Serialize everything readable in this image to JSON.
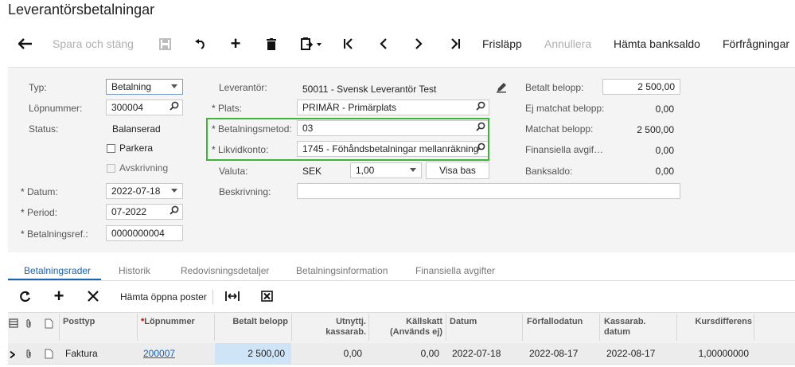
{
  "page": {
    "title": "Leverantörsbetalningar"
  },
  "toolbar": {
    "save_close": "Spara och stäng",
    "release": "Frisläpp",
    "cancel": "Annullera",
    "fetch_balance": "Hämta banksaldo",
    "inquiries": "Förfrågningar"
  },
  "form": {
    "type_label": "Typ:",
    "type_value": "Betalning",
    "refnbr_label": "Löpnummer:",
    "refnbr_value": "300004",
    "status_label": "Status:",
    "status_value": "Balanserad",
    "hold_label": "Parkera",
    "writeoff_label": "Avskrivning",
    "date_label": "Datum:",
    "date_value": "2022-07-18",
    "period_label": "Period:",
    "period_value": "07-2022",
    "payref_label": "Betalningsref.:",
    "payref_value": "0000000004",
    "vendor_label": "Leverantör:",
    "vendor_value": "50011 - Svensk Leverantör Test",
    "location_label": "Plats:",
    "location_value": "PRIMÄR - Primärplats",
    "paymethod_label": "Betalningsmetod:",
    "paymethod_value": "03",
    "cashaccount_label": "Likvidkonto:",
    "cashaccount_value": "1745 - Föhåndsbetalningar mellanräkning",
    "currency_label": "Valuta:",
    "currency_value": "SEK",
    "rate_value": "1,00",
    "view_base": "Visa bas",
    "description_label": "Beskrivning:",
    "description_value": "",
    "paid_amount_label": "Betalt belopp:",
    "paid_amount_value": "2 500,00",
    "unapplied_label": "Ej matchat belopp:",
    "unapplied_value": "0,00",
    "applied_label": "Matchat belopp:",
    "applied_value": "2 500,00",
    "fincharges_label": "Finansiella avgif…",
    "fincharges_value": "0,00",
    "bankbalance_label": "Banksaldo:",
    "bankbalance_value": "0,00"
  },
  "tabs": [
    "Betalningsrader",
    "Historik",
    "Redovisningsdetaljer",
    "Betalningsinformation",
    "Finansiella avgifter"
  ],
  "grid_toolbar": {
    "load_open": "Hämta öppna poster"
  },
  "grid": {
    "columns": {
      "doctype": "Posttyp",
      "refnbr": "Löpnummer",
      "amount": "Betalt belopp",
      "cashdisc_1": "Utnyttj.",
      "cashdisc_2": "kassarab.",
      "withholding_1": "Källskatt",
      "withholding_2": "(Används ej)",
      "date": "Datum",
      "duedate": "Förfallodatun",
      "discdate_1": "Kassarab.",
      "discdate_2": "datum",
      "ratediff": "Kursdifferens"
    },
    "rows": [
      {
        "doctype": "Faktura",
        "refnbr": "200007",
        "amount": "2 500,00",
        "cashdisc": "0,00",
        "withholding": "0,00",
        "date": "2022-07-18",
        "duedate": "2022-08-17",
        "discdate": "2022-08-17",
        "ratediff": "1,00000000"
      }
    ]
  }
}
